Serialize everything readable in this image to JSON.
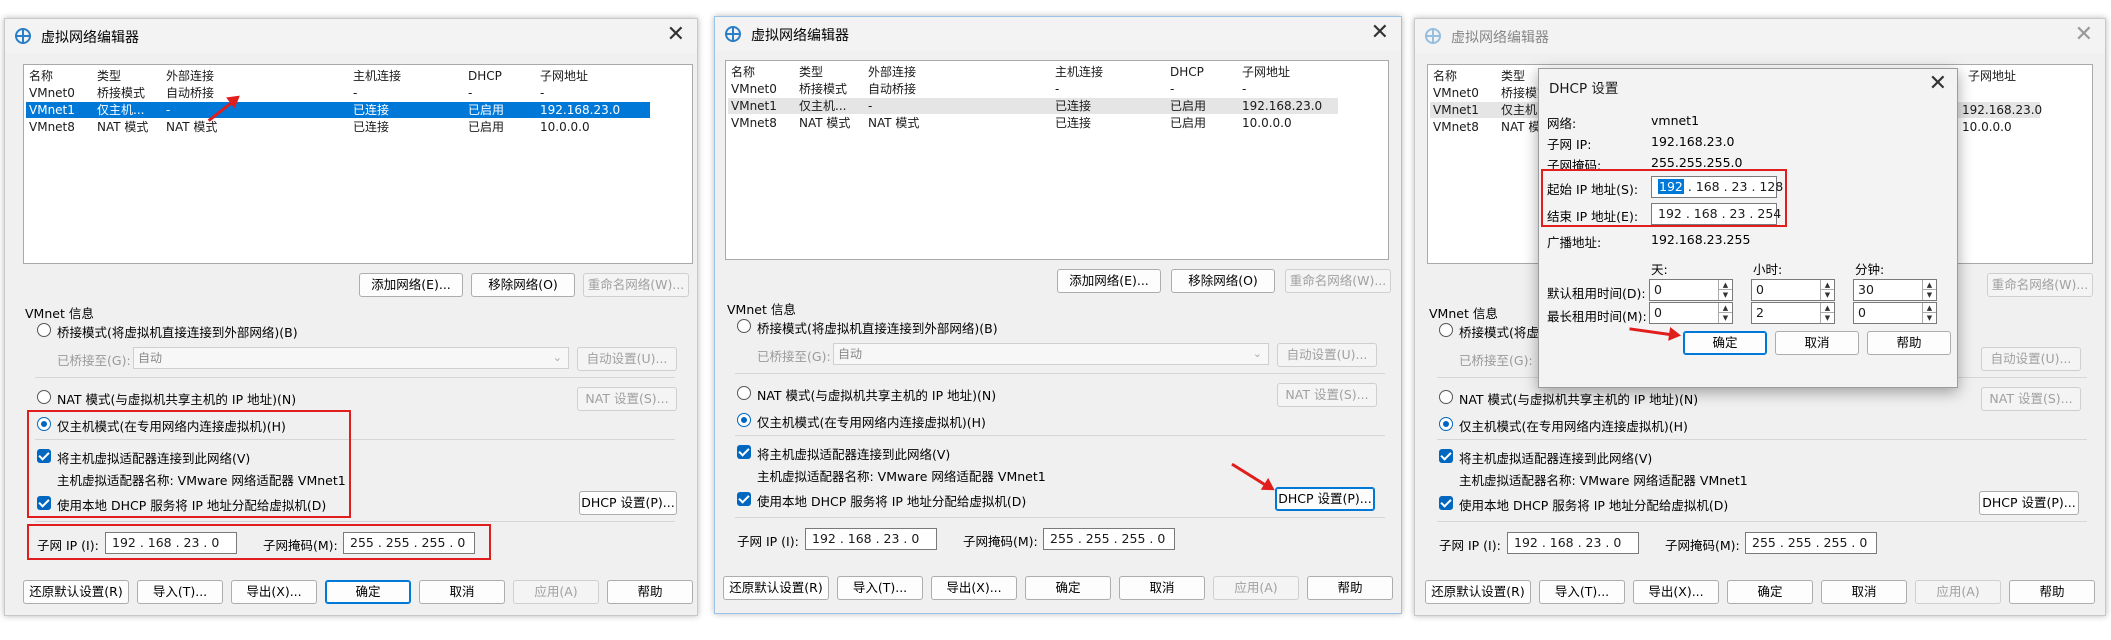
{
  "windows": [
    {
      "title": "虚拟网络编辑器",
      "table": {
        "headers": [
          "名称",
          "类型",
          "外部连接",
          "主机连接",
          "DHCP",
          "子网地址"
        ],
        "rows": [
          [
            "VMnet0",
            "桥接模式",
            "自动桥接",
            "-",
            "-",
            "-"
          ],
          [
            "VMnet1",
            "仅主机...",
            "-",
            "已连接",
            "已启用",
            "192.168.23.0"
          ],
          [
            "VMnet8",
            "NAT 模式",
            "NAT 模式",
            "已连接",
            "已启用",
            "10.0.0.0"
          ]
        ]
      },
      "add_network": "添加网络(E)...",
      "remove_network": "移除网络(O)",
      "rename_network": "重命名网络(W)...",
      "vmnet_info": "VMnet 信息",
      "bridge_mode": "桥接模式(将虚拟机直接连接到外部网络)(B)",
      "bridged_to": "已桥接至(G):",
      "bridged_value": "自动",
      "auto_settings": "自动设置(U)...",
      "nat_mode": "NAT 模式(与虚拟机共享主机的 IP 地址)(N)",
      "nat_settings": "NAT 设置(S)...",
      "host_only": "仅主机模式(在专用网络内连接虚拟机)(H)",
      "connect_adapter": "将主机虚拟适配器连接到此网络(V)",
      "adapter_name": "主机虚拟适配器名称: VMware 网络适配器 VMnet1",
      "use_dhcp": "使用本地 DHCP 服务将 IP 地址分配给虚拟机(D)",
      "dhcp_settings": "DHCP 设置(P)...",
      "subnet_ip_label": "子网 IP (I):",
      "subnet_ip": "192 . 168 . 23 . 0",
      "subnet_mask_label": "子网掩码(M):",
      "subnet_mask": "255 . 255 . 255 . 0",
      "restore": "还原默认设置(R)",
      "import": "导入(T)...",
      "export": "导出(X)...",
      "ok": "确定",
      "cancel": "取消",
      "apply": "应用(A)",
      "help": "帮助"
    }
  ],
  "dhcp_dialog": {
    "title": "DHCP 设置",
    "network_label": "网络:",
    "network": "vmnet1",
    "subnet_ip_label": "子网 IP:",
    "subnet_ip": "192.168.23.0",
    "subnet_mask_label": "子网掩码:",
    "subnet_mask": "255.255.255.0",
    "start_ip_label": "起始 IP 地址(S):",
    "start_ip_first": "192",
    "start_ip_rest": " . 168 . 23 . 128",
    "end_ip_label": "结束 IP 地址(E):",
    "end_ip": "192 . 168 . 23 . 254",
    "broadcast_label": "广播地址:",
    "broadcast": "192.168.23.255",
    "days": "天:",
    "hours": "小时:",
    "minutes": "分钟:",
    "default_lease_label": "默认租用时间(D):",
    "default_lease": [
      "0",
      "0",
      "30"
    ],
    "max_lease_label": "最长租用时间(M):",
    "max_lease": [
      "0",
      "2",
      "0"
    ],
    "ok": "确定",
    "cancel": "取消",
    "help": "帮助"
  },
  "colors": {
    "selection": "#0078d7",
    "annotation": "#e01e1e"
  }
}
